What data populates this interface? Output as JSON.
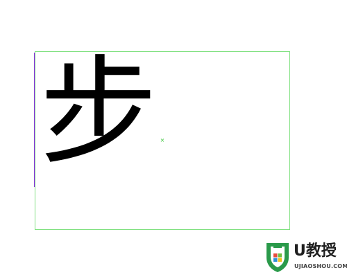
{
  "canvas": {
    "glyph": "步",
    "glyph_color": "#000000",
    "frame_color": "#7ee07e",
    "cursor_color": "#8a2be2",
    "center_mark": "×"
  },
  "watermark": {
    "title": "U教授",
    "url": "UJIAOSHOU.COM",
    "shield_color": "#2a9a4a"
  }
}
